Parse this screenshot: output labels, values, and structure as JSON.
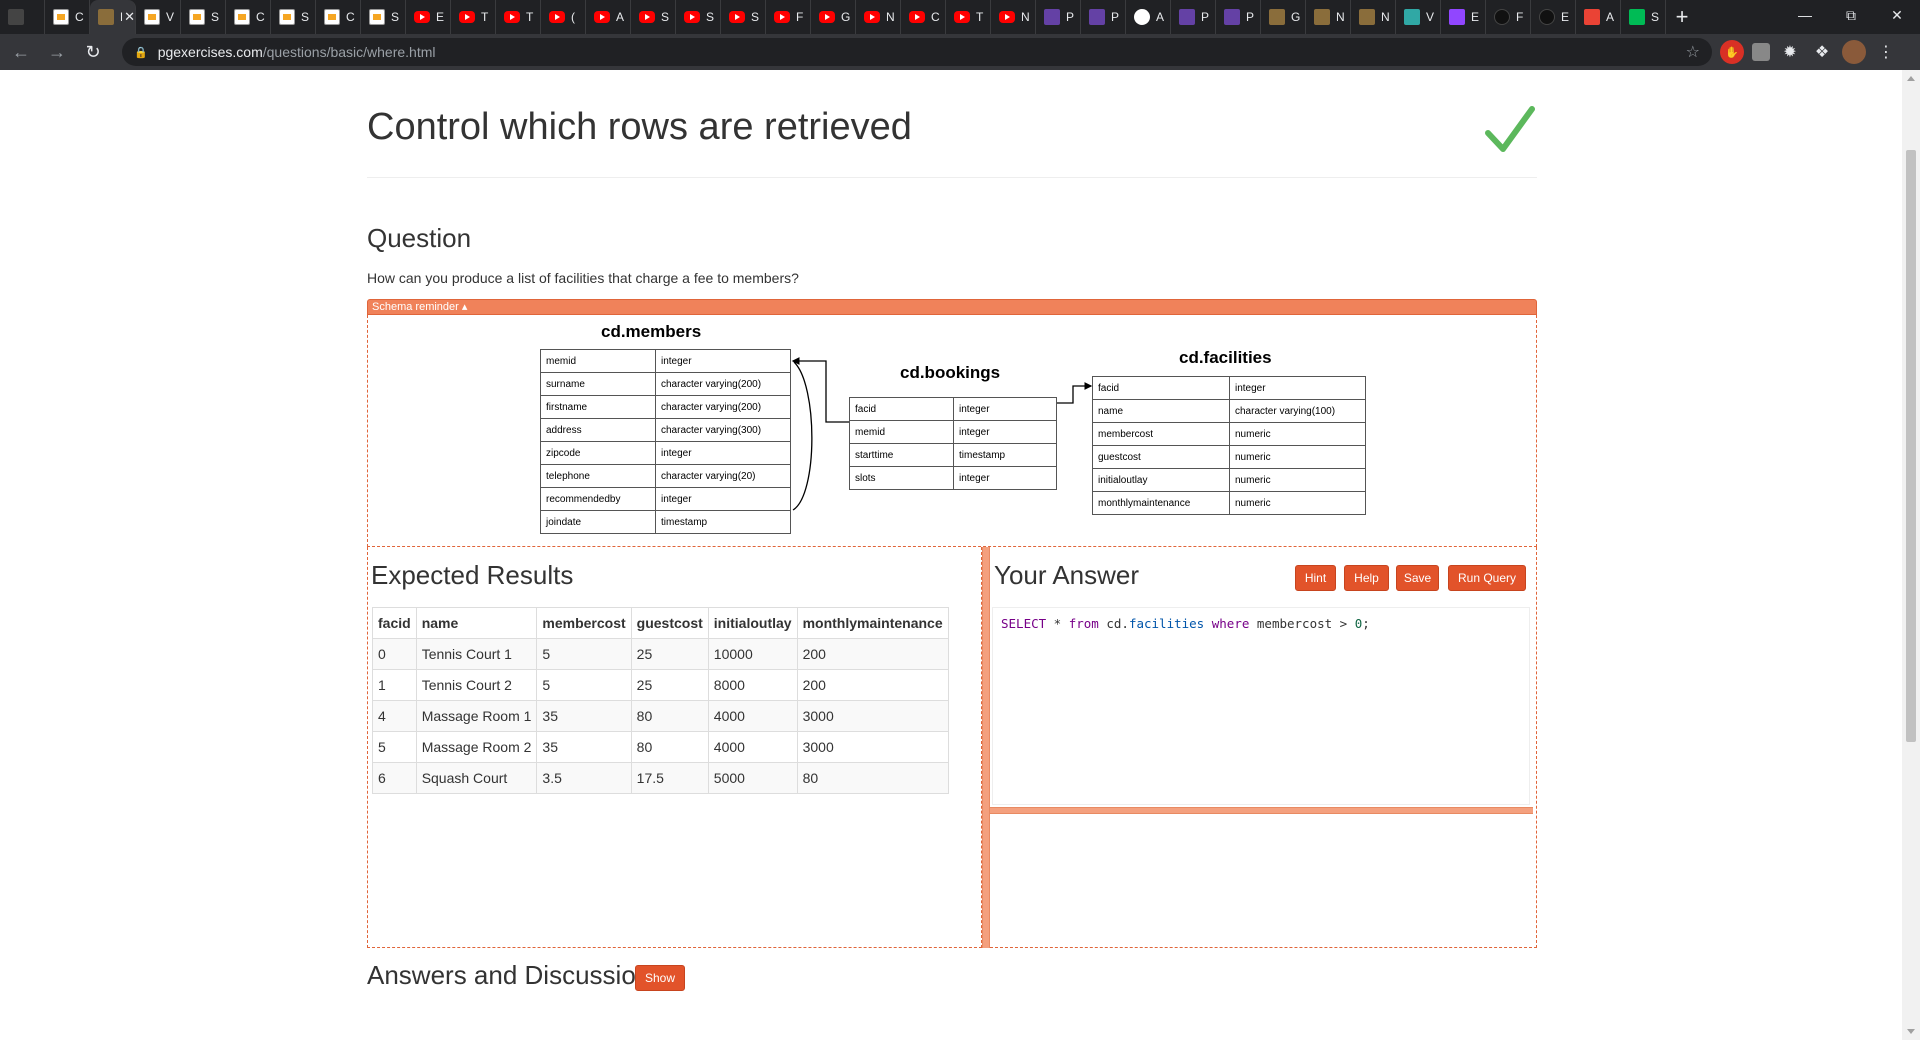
{
  "browser": {
    "tabs": [
      {
        "icon": "mountain-icon",
        "label": ""
      },
      {
        "icon": "doc-icon",
        "label": "C"
      },
      {
        "icon": "pg-icon",
        "label": "Pc",
        "active": true
      },
      {
        "icon": "doc-icon",
        "label": "V"
      },
      {
        "icon": "doc-icon",
        "label": "S"
      },
      {
        "icon": "doc-icon",
        "label": "C"
      },
      {
        "icon": "doc-icon",
        "label": "S"
      },
      {
        "icon": "doc-icon",
        "label": "C"
      },
      {
        "icon": "doc-icon",
        "label": "S"
      },
      {
        "icon": "youtube-icon",
        "label": "E"
      },
      {
        "icon": "youtube-icon",
        "label": "T"
      },
      {
        "icon": "youtube-icon",
        "label": "T"
      },
      {
        "icon": "youtube-icon",
        "label": "("
      },
      {
        "icon": "youtube-icon",
        "label": "A"
      },
      {
        "icon": "youtube-icon",
        "label": "S"
      },
      {
        "icon": "youtube-icon",
        "label": "S"
      },
      {
        "icon": "youtube-icon",
        "label": "S"
      },
      {
        "icon": "youtube-icon",
        "label": "F"
      },
      {
        "icon": "youtube-icon",
        "label": "G"
      },
      {
        "icon": "youtube-icon",
        "label": "N"
      },
      {
        "icon": "youtube-icon",
        "label": "C"
      },
      {
        "icon": "youtube-icon",
        "label": "T"
      },
      {
        "icon": "youtube-icon",
        "label": "N"
      },
      {
        "icon": "crown-icon",
        "label": "P"
      },
      {
        "icon": "crown-icon",
        "label": "P"
      },
      {
        "icon": "gear-icon",
        "label": "A"
      },
      {
        "icon": "crown-icon",
        "label": "P"
      },
      {
        "icon": "crown-icon",
        "label": "P"
      },
      {
        "icon": "pg-icon",
        "label": "G"
      },
      {
        "icon": "pg-icon",
        "label": "N"
      },
      {
        "icon": "pg-icon",
        "label": "N"
      },
      {
        "icon": "web-icon",
        "label": "V"
      },
      {
        "icon": "twitch-icon",
        "label": "E"
      },
      {
        "icon": "github-icon",
        "label": "F"
      },
      {
        "icon": "github-icon",
        "label": "E"
      },
      {
        "icon": "target-icon",
        "label": "A"
      },
      {
        "icon": "gmail-icon",
        "label": "S"
      }
    ],
    "url_host": "pgexercises.com",
    "url_path": "/questions/basic/where.html"
  },
  "page": {
    "title": "Control which rows are retrieved",
    "question_heading": "Question",
    "question_text": "How can you produce a list of facilities that charge a fee to members?",
    "schema_toggle": "Schema reminder ▴",
    "expected_heading": "Expected Results",
    "answer_heading": "Your Answer",
    "answers_heading": "Answers and Discussion",
    "show_label": "Show",
    "buttons": {
      "hint": "Hint",
      "help": "Help",
      "save": "Save",
      "run": "Run Query"
    },
    "query": {
      "kw1": "SELECT",
      "star": " * ",
      "kw2": "from",
      "schema": " cd.",
      "table": "facilities",
      "kw3": " where",
      "col": " membercost > ",
      "num": "0",
      "end": ";"
    }
  },
  "schema": {
    "members": {
      "title": "cd.members",
      "rows": [
        [
          "memid",
          "integer"
        ],
        [
          "surname",
          "character varying(200)"
        ],
        [
          "firstname",
          "character varying(200)"
        ],
        [
          "address",
          "character varying(300)"
        ],
        [
          "zipcode",
          "integer"
        ],
        [
          "telephone",
          "character varying(20)"
        ],
        [
          "recommendedby",
          "integer"
        ],
        [
          "joindate",
          "timestamp"
        ]
      ]
    },
    "bookings": {
      "title": "cd.bookings",
      "rows": [
        [
          "facid",
          "integer"
        ],
        [
          "memid",
          "integer"
        ],
        [
          "starttime",
          "timestamp"
        ],
        [
          "slots",
          "integer"
        ]
      ]
    },
    "facilities": {
      "title": "cd.facilities",
      "rows": [
        [
          "facid",
          "integer"
        ],
        [
          "name",
          "character varying(100)"
        ],
        [
          "membercost",
          "numeric"
        ],
        [
          "guestcost",
          "numeric"
        ],
        [
          "initialoutlay",
          "numeric"
        ],
        [
          "monthlymaintenance",
          "numeric"
        ]
      ]
    }
  },
  "results": {
    "columns": [
      "facid",
      "name",
      "membercost",
      "guestcost",
      "initialoutlay",
      "monthlymaintenance"
    ],
    "rows": [
      [
        "0",
        "Tennis Court 1",
        "5",
        "25",
        "10000",
        "200"
      ],
      [
        "1",
        "Tennis Court 2",
        "5",
        "25",
        "8000",
        "200"
      ],
      [
        "4",
        "Massage Room 1",
        "35",
        "80",
        "4000",
        "3000"
      ],
      [
        "5",
        "Massage Room 2",
        "35",
        "80",
        "4000",
        "3000"
      ],
      [
        "6",
        "Squash Court",
        "3.5",
        "17.5",
        "5000",
        "80"
      ]
    ]
  },
  "colors": {
    "accent": "#e2532a",
    "schema_bar": "#f0825a",
    "check": "#5cb85c"
  }
}
